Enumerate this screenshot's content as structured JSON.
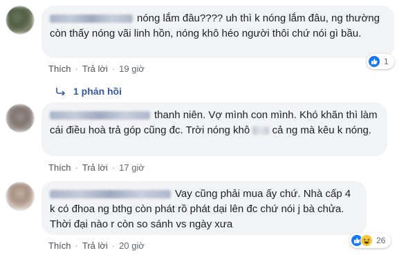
{
  "comments": [
    {
      "text": "nóng lắm đâu???? uh thì k nóng lắm đâu, ng thường còn thấy nóng vãi linh hồn, nóng khô héo người thôi chứ nói gì bầu.",
      "like_label": "Thích",
      "reply_label": "Trả lời",
      "time": "19 giờ",
      "reaction_count": "1",
      "reactions": [
        "like-icon"
      ],
      "replies_label": "1 phản hồi"
    },
    {
      "text_before": "thanh niên. Vợ mình con mình. Khó khăn thì làm cái điều hoà trả góp cũng đc. Trời nóng khô",
      "text_after": "cả ng mà kêu k nóng.",
      "like_label": "Thích",
      "reply_label": "Trả lời",
      "time": "17 giờ"
    },
    {
      "text": "Vay cũng phải mua ấy chứ. Nhà cấp 4 k có đhoa ng bthg còn phát rồ phát dại lên đc chứ nói j bà chửa. Thời đại nào r còn so sánh vs ngày xưa",
      "like_label": "Thích",
      "reply_label": "Trả lời",
      "time": "20 giờ",
      "reaction_count": "26",
      "reactions": [
        "like-icon",
        "haha-icon"
      ]
    }
  ],
  "colors": {
    "bubble": "#f2f3f5",
    "link_blue": "#385898",
    "meta_gray": "#606770",
    "like_blue": "#1877f2"
  }
}
